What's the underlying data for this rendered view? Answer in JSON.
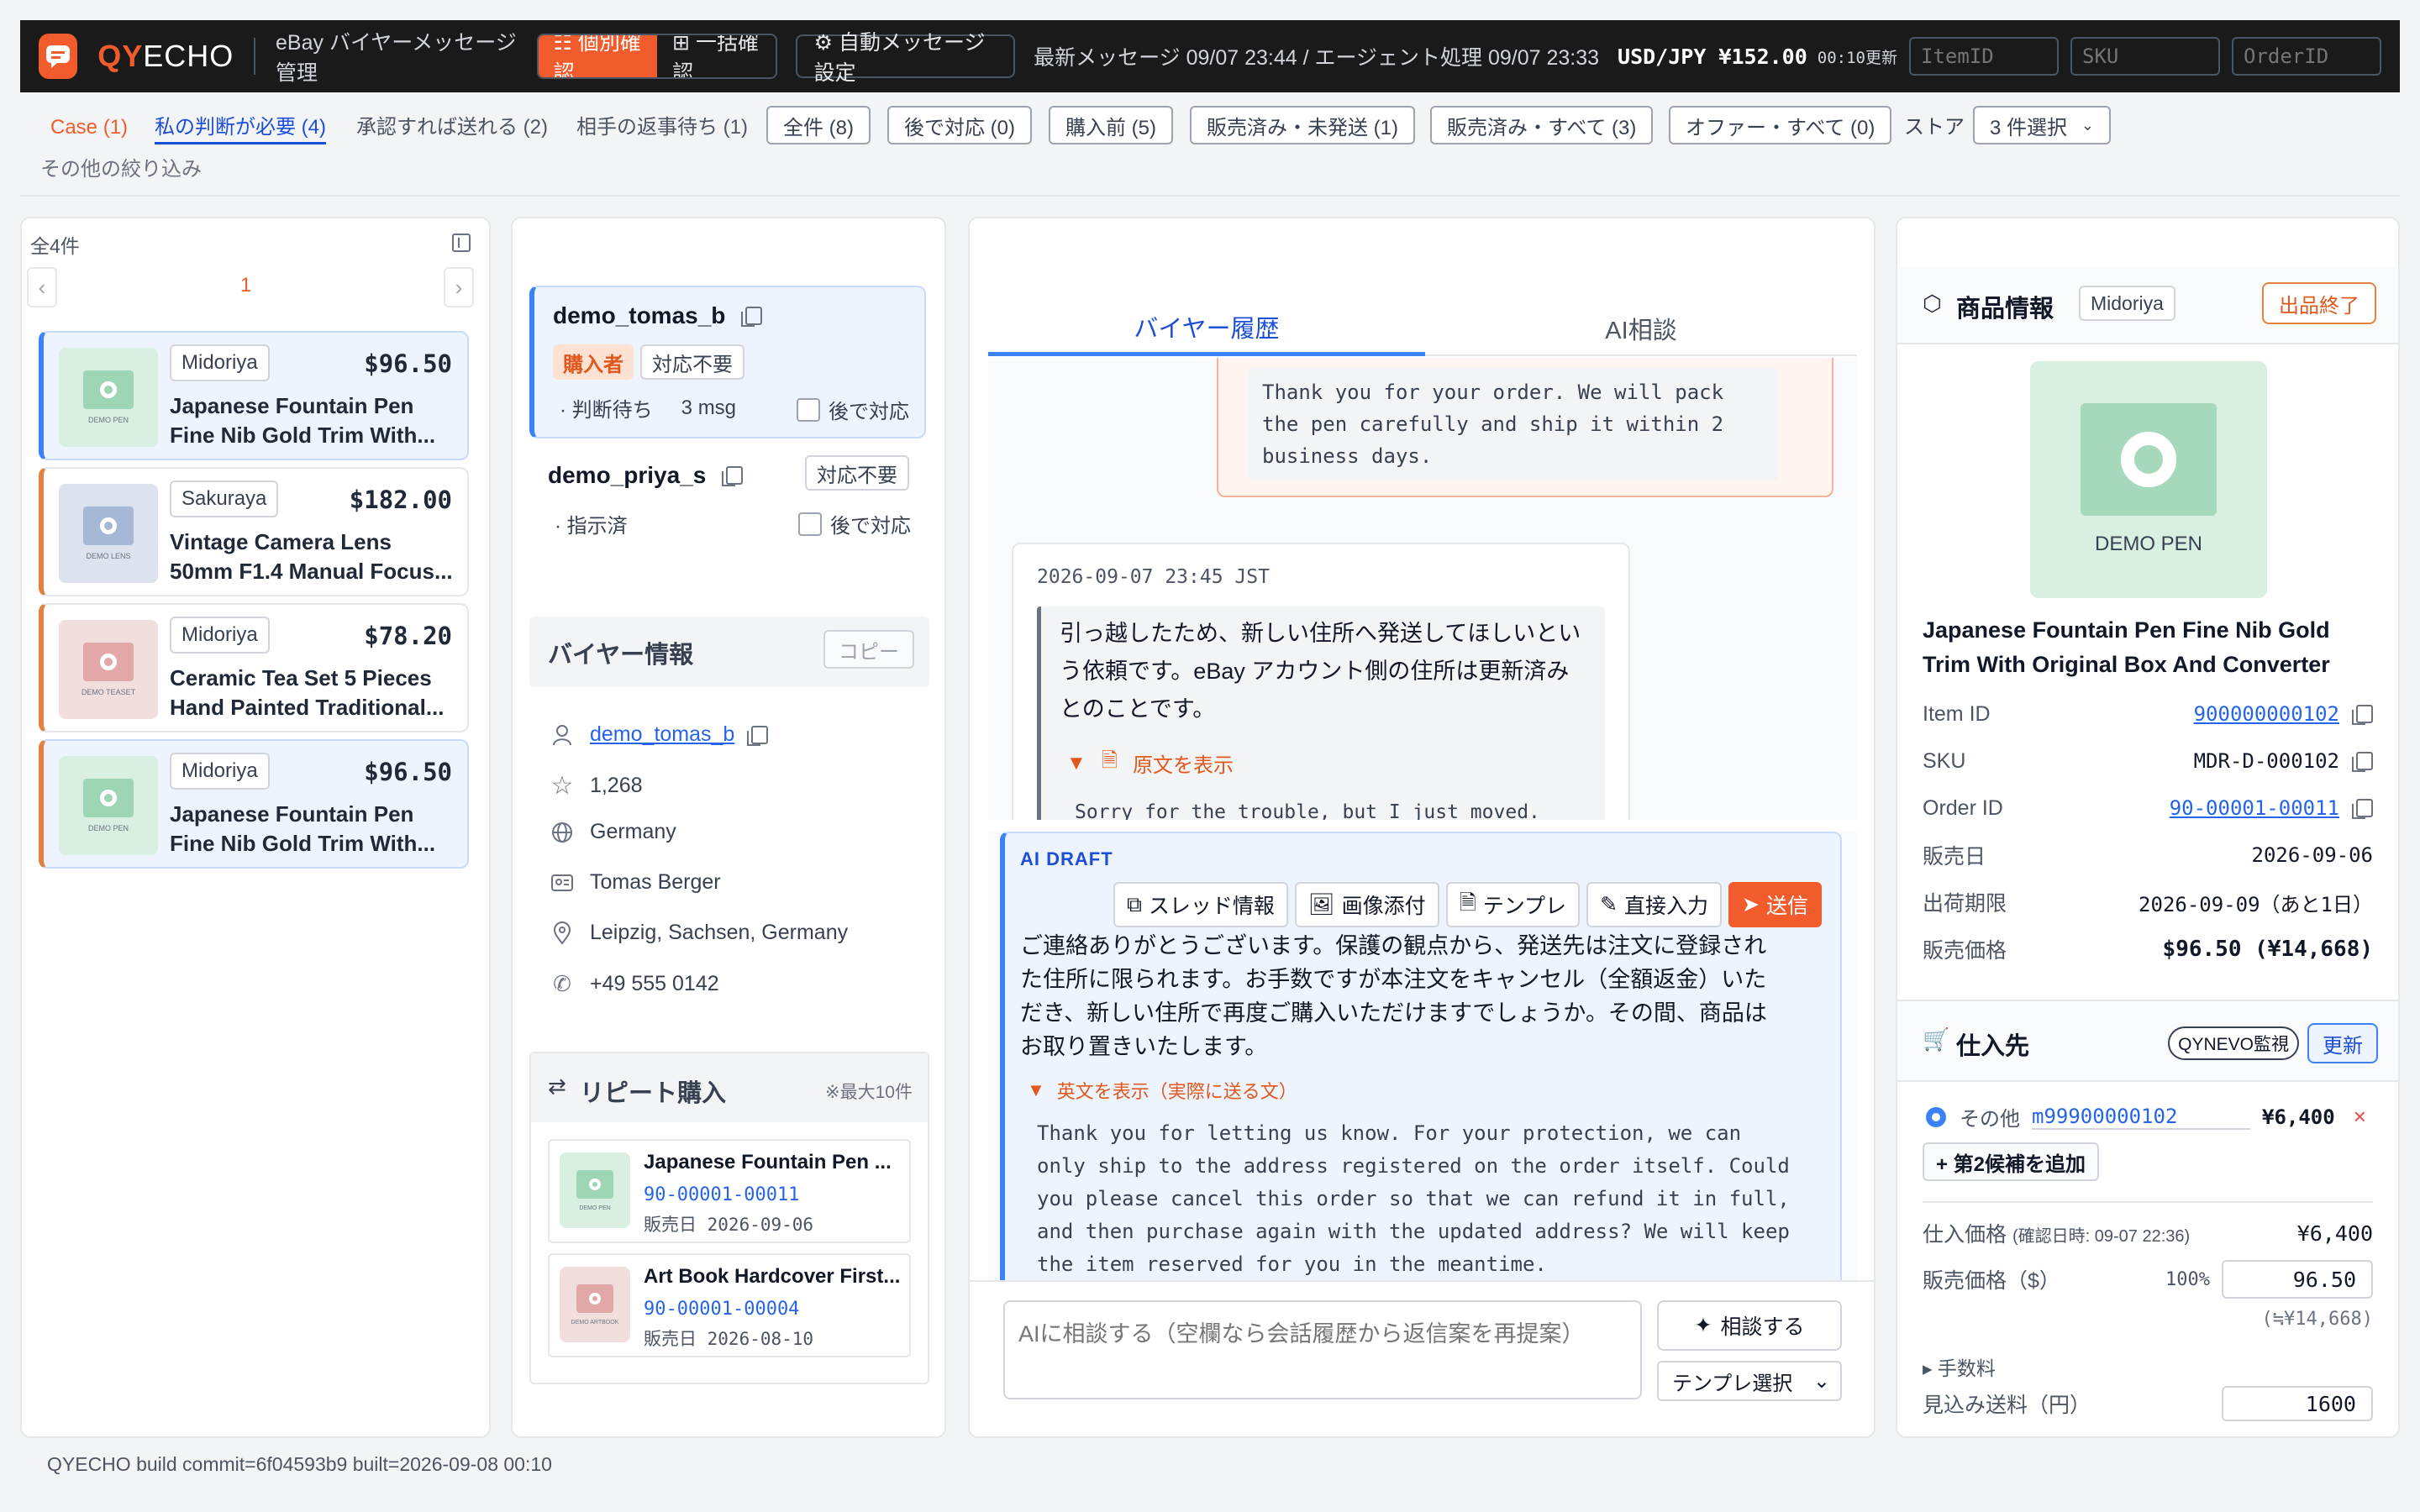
{
  "topbar": {
    "brand_a": "QY",
    "brand_b": "ECHO",
    "app_title": "eBay バイヤーメッセージ管理",
    "mode_individual": "☷ 個別確認",
    "mode_bulk": "⊞ 一括確認",
    "auto_message": "⚙ 自動メッセージ設定",
    "status": "最新メッセージ 09/07 23:44 / エージェント処理 09/07 23:33",
    "fx": "USD/JPY ¥152.00",
    "fx_time": "00:10更新",
    "itemid_placeholder": "ItemID",
    "sku_placeholder": "SKU",
    "orderid_placeholder": "OrderID"
  },
  "filters": {
    "case": "Case (1)",
    "needs_judgment": "私の判断が必要 (4)",
    "approve_send": "承認すれば送れる (2)",
    "waiting_reply": "相手の返事待ち (1)",
    "all": "全件 (8)",
    "later": "後で対応 (0)",
    "pre_purchase": "購入前 (5)",
    "sold_unshipped": "販売済み・未発送 (1)",
    "sold_all": "販売済み・すべて (3)",
    "offer_all": "オファー・すべて (0)",
    "store_label": "ストア",
    "store_select": "3 件選択",
    "more_filters": "その他の絞り込み"
  },
  "list": {
    "count": "全4件",
    "page": "1",
    "items": [
      {
        "store": "Midoriya",
        "price": "$96.50",
        "title1": "Japanese Fountain Pen",
        "title2": "Fine Nib Gold Trim With...",
        "thumb": "DEMO PEN"
      },
      {
        "store": "Sakuraya",
        "price": "$182.00",
        "title1": "Vintage Camera Lens",
        "title2": "50mm F1.4 Manual Focus...",
        "thumb": "DEMO LENS"
      },
      {
        "store": "Midoriya",
        "price": "$78.20",
        "title1": "Ceramic Tea Set 5 Pieces",
        "title2": "Hand Painted Traditional...",
        "thumb": "DEMO TEASET"
      },
      {
        "store": "Midoriya",
        "price": "$96.50",
        "title1": "Japanese Fountain Pen",
        "title2": "Fine Nib Gold Trim With...",
        "thumb": "DEMO PEN"
      }
    ]
  },
  "threads": {
    "t1": {
      "name": "demo_tomas_b",
      "role": "購入者",
      "status": "対応不要",
      "state": "· 判断待ち",
      "msgs": "3 msg",
      "later": "後で対応"
    },
    "t2": {
      "name": "demo_priya_s",
      "status": "対応不要",
      "state": "· 指示済",
      "later": "後で対応"
    }
  },
  "buyer": {
    "title": "バイヤー情報",
    "copy": "コピー",
    "username": "demo_tomas_b",
    "feedback": "1,268",
    "country": "Germany",
    "name": "Tomas Berger",
    "location": "Leipzig, Sachsen, Germany",
    "phone": "+49 555 0142"
  },
  "repeat": {
    "title": "リピート購入",
    "note": "※最大10件",
    "items": [
      {
        "title": "Japanese Fountain Pen ...",
        "order": "90-00001-00011",
        "date": "販売日  2026-09-06",
        "thumb": "DEMO PEN"
      },
      {
        "title": "Art Book Hardcover First...",
        "order": "90-00001-00004",
        "date": "販売日  2026-08-10",
        "thumb": "DEMO ARTBOOK"
      }
    ]
  },
  "conversation": {
    "tab_history": "バイヤー履歴",
    "tab_ai": "AI相談",
    "seller_msg": "Thank you for your order. We will pack the pen carefully and ship it within 2 business days.",
    "buyer_time": "2026-09-07 23:45 JST",
    "buyer_msg": "引っ越したため、新しい住所へ発送してほしいという依頼です。eBay アカウント側の住所は更新済みとのことです。",
    "show_original": "原文を表示",
    "original_preview": "Sorry for the trouble, but I just moved.",
    "draft_label": "AI DRAFT",
    "btn_thread": "スレッド情報",
    "btn_image": "画像添付",
    "btn_template": "テンプレ",
    "btn_direct": "直接入力",
    "btn_send": "送信",
    "draft_ja": "ご連絡ありがとうございます。保護の観点から、発送先は注文に登録された住所に限られます。お手数ですが本注文をキャンセル（全額返金）いただき、新しい住所で再度ご購入いただけますでしょうか。その間、商品はお取り置きいたします。",
    "show_english": "英文を表示（実際に送る文）",
    "draft_en": "Thank you for letting us know. For your protection, we can only ship to the address registered on the order itself. Could you please cancel this order so that we can refund it in full, and then purchase again with the updated address? We will keep the item reserved for you in the meantime.",
    "consult_placeholder": "AIに相談する（空欄なら会話履歴から返信案を再提案）",
    "consult_btn": "相談する",
    "template_select": "テンプレ選択"
  },
  "product": {
    "title": "商品情報",
    "store": "Midoriya",
    "ended": "出品終了",
    "image_label": "DEMO PEN",
    "name": "Japanese Fountain Pen Fine Nib Gold Trim With Original Box And Converter",
    "item_id_label": "Item ID",
    "item_id": "900000000102",
    "sku_label": "SKU",
    "sku": "MDR-D-000102",
    "order_id_label": "Order ID",
    "order_id": "90-00001-00011",
    "sold_label": "販売日",
    "sold": "2026-09-06",
    "ship_label": "出荷期限",
    "ship": "2026-09-09（あと1日）",
    "price_label": "販売価格",
    "price": "$96.50 (¥14,668)"
  },
  "supplier": {
    "title": "仕入先",
    "monitor": "QYNEVO監視",
    "update": "更新",
    "other": "その他",
    "code": "m99900000102",
    "amount": "¥6,400",
    "add_second": "+ 第2候補を追加",
    "cost_label": "仕入価格",
    "cost_note": "(確認日時: 09-07 22:36)",
    "cost": "¥6,400",
    "sale_label": "販売価格（$）",
    "sale_pct": "100%",
    "sale_value": "96.50",
    "sale_yen": "(≒¥14,668)",
    "fee_label": "▸ 手数料",
    "ship_cost_label": "見込み送料（円）",
    "ship_cost": "1600"
  },
  "footer": "QYECHO build commit=6f04593b9 built=2026-09-08 00:10",
  "colors": {
    "accent": "#f25c2c",
    "link": "#2563eb",
    "buyer_border": "#3b82f6",
    "draft_border": "#3b82f6"
  }
}
